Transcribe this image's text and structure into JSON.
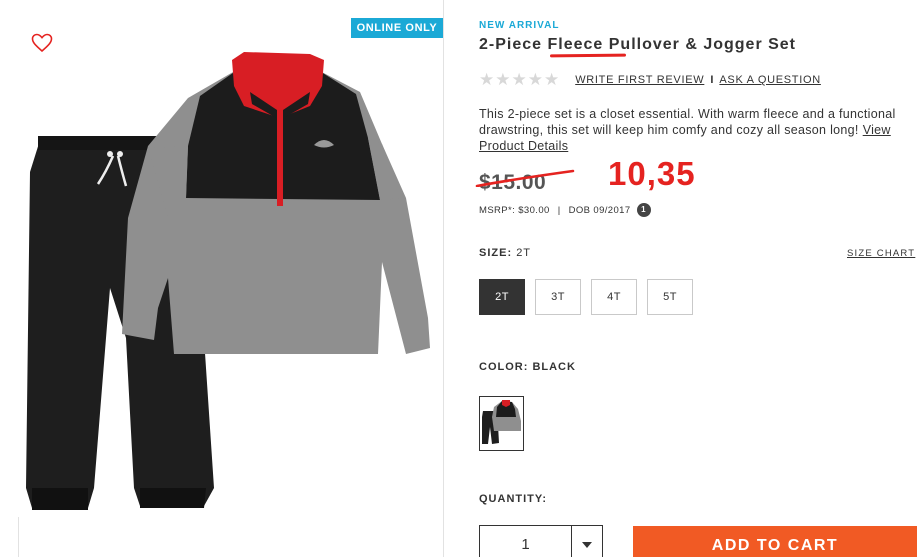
{
  "badge": {
    "online_only": "ONLINE ONLY"
  },
  "product": {
    "new_arrival": "NEW ARRIVAL",
    "title": "2-Piece Fleece Pullover & Jogger Set",
    "stars": "★★★★★",
    "rating_value": 0,
    "rating_max": 5,
    "write_review": "WRITE FIRST REVIEW",
    "divider": "I",
    "ask_question": "ASK A QUESTION",
    "description": "This 2-piece set is a closet essential. With warm fleece and a functional drawstring, this set will keep him comfy and cozy all season long!",
    "view_details": "View Product Details",
    "price": "$15.00",
    "annotated_price": "10,35",
    "msrp": "MSRP*: $30.00",
    "separator": "|",
    "dob": "DOB 09/2017",
    "info_badge": "1"
  },
  "size": {
    "label": "SIZE:",
    "selected": "2T",
    "chart_link": "SIZE CHART",
    "options": [
      "2T",
      "3T",
      "4T",
      "5T"
    ]
  },
  "color": {
    "label": "COLOR:",
    "selected": "BLACK"
  },
  "quantity": {
    "label": "QUANTITY:",
    "value": "1"
  },
  "actions": {
    "add_to_cart": "ADD TO CART"
  },
  "colors": {
    "accent_blue": "#1ba9d6",
    "cta_orange": "#f15a24",
    "annotation_red": "#e52320"
  },
  "icons": {
    "favorite": "heart-outline-icon",
    "quantity_dropdown": "chevron-down-icon"
  }
}
